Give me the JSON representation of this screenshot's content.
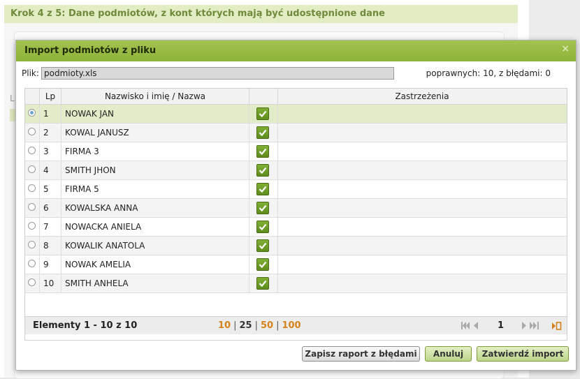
{
  "background": {
    "step_title": "Krok 4 z 5: Dane podmiotów, z kont których mają być udostępnione dane",
    "side_letter": "L"
  },
  "dialog": {
    "title": "Import podmiotów z pliku",
    "close_glyph": "×",
    "file_label": "Plik:",
    "file_value": "podmioty.xls",
    "stats": "poprawnych: 10, z błędami: 0"
  },
  "table": {
    "columns": {
      "lp": "Lp",
      "name": "Nazwisko i imię / Nazwa",
      "notes": "Zastrzeżenia"
    },
    "rows": [
      {
        "lp": "1",
        "name": "NOWAK JAN",
        "valid": true,
        "selected": true,
        "notes": ""
      },
      {
        "lp": "2",
        "name": "KOWAL JANUSZ",
        "valid": true,
        "selected": false,
        "notes": ""
      },
      {
        "lp": "3",
        "name": "FIRMA 3",
        "valid": true,
        "selected": false,
        "notes": ""
      },
      {
        "lp": "4",
        "name": "SMITH JHON",
        "valid": true,
        "selected": false,
        "notes": ""
      },
      {
        "lp": "5",
        "name": "FIRMA 5",
        "valid": true,
        "selected": false,
        "notes": ""
      },
      {
        "lp": "6",
        "name": "KOWALSKA ANNA",
        "valid": true,
        "selected": false,
        "notes": ""
      },
      {
        "lp": "7",
        "name": "NOWACKA ANIELA",
        "valid": true,
        "selected": false,
        "notes": ""
      },
      {
        "lp": "8",
        "name": "KOWALIK ANATOLA",
        "valid": true,
        "selected": false,
        "notes": ""
      },
      {
        "lp": "9",
        "name": "NOWAK AMELIA",
        "valid": true,
        "selected": false,
        "notes": ""
      },
      {
        "lp": "10",
        "name": "SMITH ANHELA",
        "valid": true,
        "selected": false,
        "notes": ""
      }
    ]
  },
  "footer": {
    "count": "Elementy 1 - 10 z 10",
    "page_sizes": [
      "10",
      "25",
      "50",
      "100"
    ],
    "current_page_size": "25",
    "page": "1"
  },
  "buttons": {
    "report": "Zapisz raport z błędami",
    "cancel": "Anuluj",
    "confirm": "Zatwierdź import"
  },
  "colors": {
    "accent": "#8db33a",
    "link": "#d5821b",
    "selected_row": "#e3ecc9"
  }
}
